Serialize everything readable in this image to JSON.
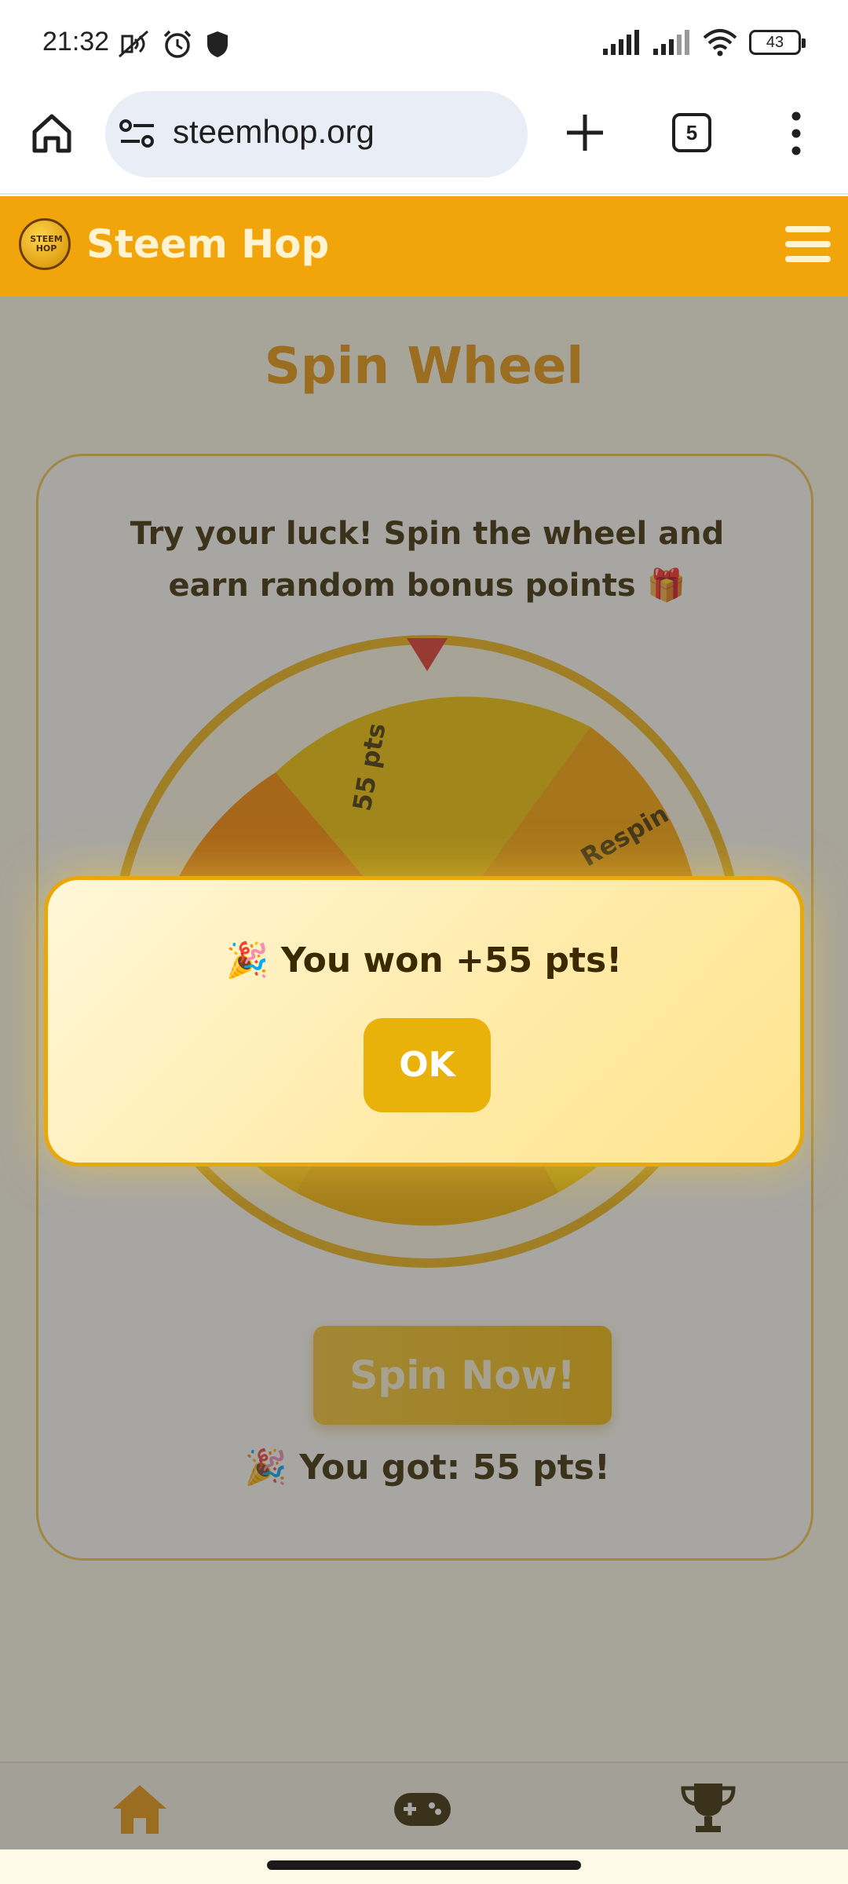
{
  "status": {
    "time": "21:32",
    "battery": "43"
  },
  "browser": {
    "url": "steemhop.org",
    "tab_count": "5"
  },
  "app": {
    "title": "Steem Hop",
    "logo_text": "STEEM HOP"
  },
  "page": {
    "title": "Spin Wheel",
    "description": "Try your luck! Spin the wheel and earn random bonus points 🎁",
    "wheel_labels": [
      "55 pts",
      "Respin"
    ],
    "spin_button": "Spin Now!",
    "result": "🎉 You got: 55 pts!"
  },
  "modal": {
    "message": "🎉 You won +55 pts!",
    "ok_label": "OK"
  },
  "bottom_nav": {
    "items": [
      "home-icon",
      "gamepad-icon",
      "trophy-icon"
    ],
    "active_color": "#e8950c"
  },
  "colors": {
    "brand": "#f1a50a",
    "accent": "#e8b20a",
    "text": "#3b2a00"
  }
}
